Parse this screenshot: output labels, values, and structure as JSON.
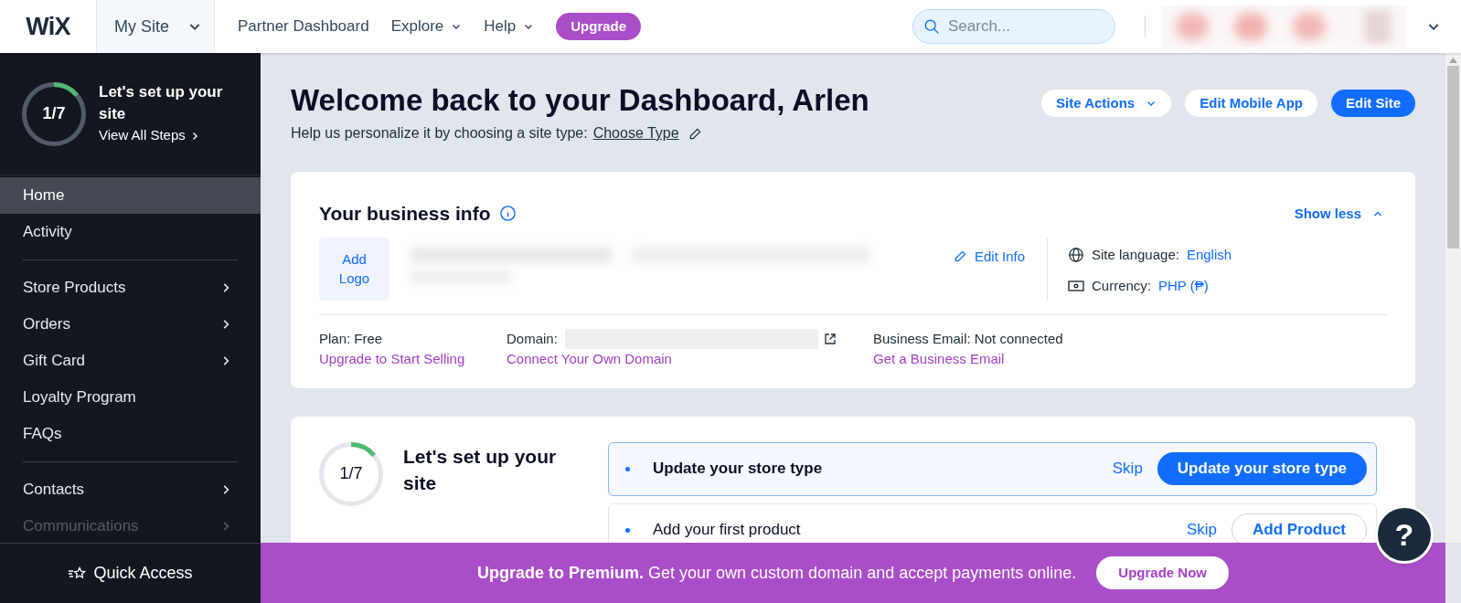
{
  "topbar": {
    "logo": "WiX",
    "site_menu": "My Site",
    "nav": [
      {
        "label": "Partner Dashboard",
        "dropdown": false
      },
      {
        "label": "Explore",
        "dropdown": true
      },
      {
        "label": "Help",
        "dropdown": true
      }
    ],
    "upgrade": "Upgrade",
    "search": {
      "placeholder": "Search..."
    }
  },
  "sidebar": {
    "setup": {
      "progress": "1/7",
      "level": 0.14,
      "title": "Let's set up your site",
      "link": "View All Steps"
    },
    "groups": [
      [
        {
          "label": "Home",
          "selected": true,
          "submenu": false
        },
        {
          "label": "Activity",
          "selected": false,
          "submenu": false
        }
      ],
      [
        {
          "label": "Store Products",
          "selected": false,
          "submenu": true
        },
        {
          "label": "Orders",
          "selected": false,
          "submenu": true
        },
        {
          "label": "Gift Card",
          "selected": false,
          "submenu": true
        },
        {
          "label": "Loyalty Program",
          "selected": false,
          "submenu": false
        },
        {
          "label": "FAQs",
          "selected": false,
          "submenu": false
        }
      ],
      [
        {
          "label": "Contacts",
          "selected": false,
          "submenu": true
        },
        {
          "label": "Communications",
          "selected": false,
          "submenu": true
        }
      ]
    ],
    "quick_access": "Quick Access"
  },
  "header": {
    "title": "Welcome back to your Dashboard, Arlen",
    "subtitle": "Help us personalize it by choosing a site type:",
    "link": "Choose Type",
    "buttons": [
      {
        "label": "Site Actions",
        "kind": "dropdown"
      },
      {
        "label": "Edit Mobile App",
        "kind": "secondary"
      },
      {
        "label": "Edit Site",
        "kind": "primary"
      }
    ]
  },
  "business_info": {
    "title": "Your business info",
    "toggle": "Show less",
    "add_logo": "Add Logo",
    "edit": "Edit Info",
    "settings": [
      {
        "label": "Site language:",
        "value": "English",
        "kind": "language"
      },
      {
        "label": "Currency:",
        "value": "PHP (₱)",
        "kind": "currency"
      }
    ],
    "footer": [
      {
        "label": "Plan: Free",
        "link": "Upgrade to Start Selling",
        "kind": "plain"
      },
      {
        "label": "Domain:",
        "link": "Connect Your Own Domain",
        "kind": "domain"
      },
      {
        "label": "Business Email: Not connected",
        "link": "Get a Business Email",
        "kind": "plain"
      }
    ]
  },
  "setup_card": {
    "progress": "1/7",
    "level": 0.14,
    "title": "Let's set up your site",
    "tasks": [
      {
        "label": "Update your store type",
        "selected": true,
        "skip": "Skip",
        "action": "Update your store type"
      },
      {
        "label": "Add your first product",
        "selected": false,
        "skip": "Skip",
        "action": "Add Product"
      }
    ]
  },
  "banner": {
    "bold": "Upgrade to Premium.",
    "text": "Get your own custom domain and accept payments online.",
    "button": "Upgrade Now"
  },
  "help": "?"
}
